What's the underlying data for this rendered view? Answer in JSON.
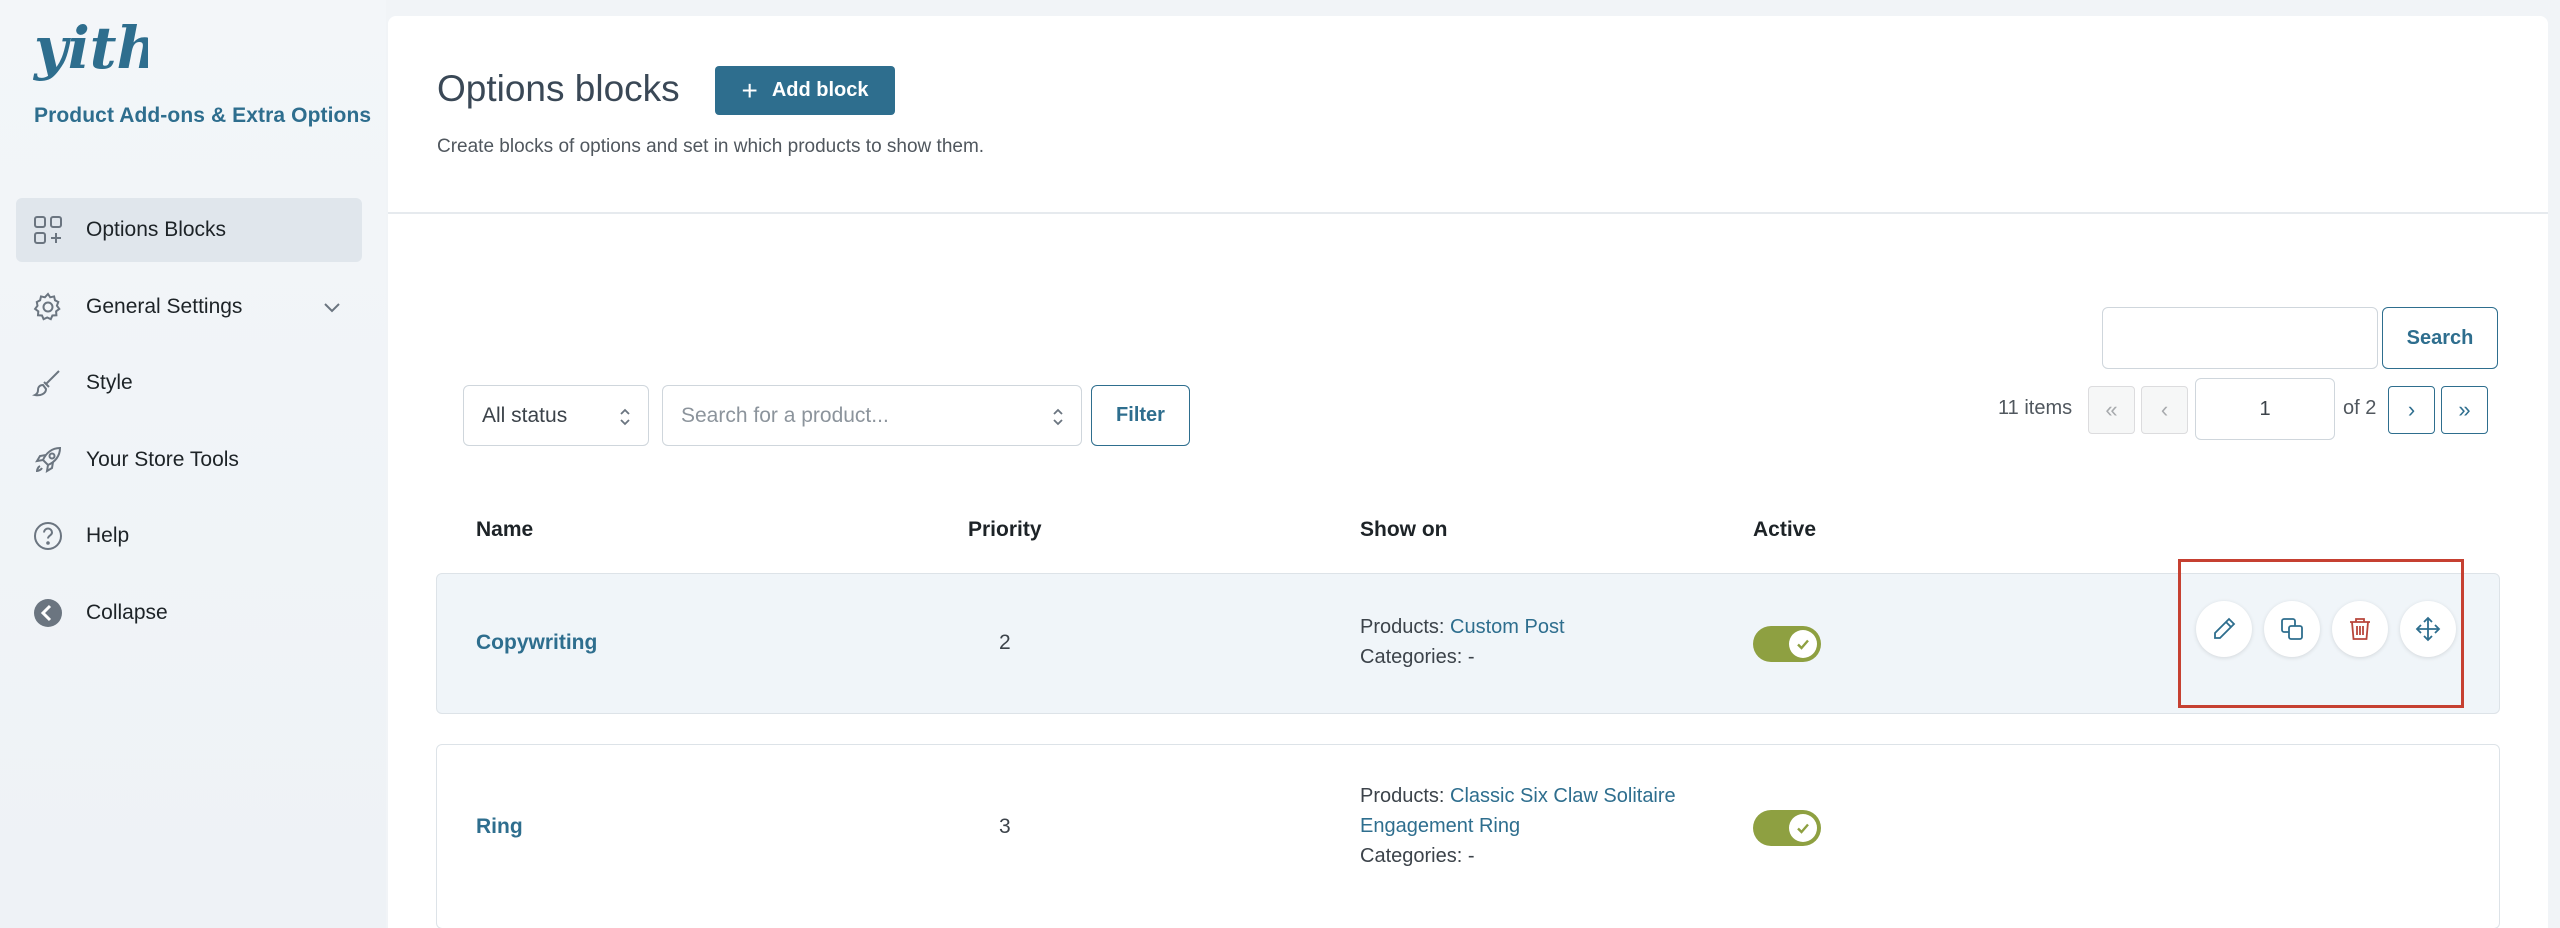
{
  "sidebar": {
    "logo_text": "yith",
    "plugin_name": "Product Add-ons & Extra Options",
    "items": [
      {
        "label": "Options Blocks",
        "icon": "blocks-icon",
        "active": true
      },
      {
        "label": "General Settings",
        "icon": "gear-icon",
        "has_submenu": true
      },
      {
        "label": "Style",
        "icon": "brush-icon"
      },
      {
        "label": "Your Store Tools",
        "icon": "rocket-icon"
      },
      {
        "label": "Help",
        "icon": "help-icon"
      },
      {
        "label": "Collapse",
        "icon": "collapse-arrow-icon"
      }
    ]
  },
  "header": {
    "title": "Options blocks",
    "add_button": "Add block",
    "description": "Create blocks of options and set in which products to show them."
  },
  "search": {
    "value": "",
    "button": "Search"
  },
  "filters": {
    "status_selected": "All status",
    "product_placeholder": "Search for a product...",
    "filter_button": "Filter"
  },
  "pagination": {
    "items_count": "11 items",
    "first": "«",
    "prev": "‹",
    "current_page": "1",
    "of_pages": "of 2",
    "next": "›",
    "last": "»"
  },
  "table": {
    "columns": [
      "Name",
      "Priority",
      "Show on",
      "Active"
    ],
    "rows": [
      {
        "name": "Copywriting",
        "priority": "2",
        "products_label": "Products:",
        "products_value": "Custom Post",
        "categories_label": "Categories:",
        "categories_value": "-",
        "active": true
      },
      {
        "name": "Ring",
        "priority": "3",
        "products_label": "Products:",
        "products_value_line1": "Classic Six Claw Solitaire",
        "products_value_line2": "Engagement Ring",
        "categories_label": "Categories:",
        "categories_value": "-",
        "active": true
      }
    ]
  },
  "row_actions": [
    "pencil-icon",
    "duplicate-icon",
    "trash-icon",
    "move-icon"
  ],
  "colors": {
    "brand": "#2e6e8e",
    "toggle_on": "#8ea041",
    "delete": "#b8463b",
    "highlight_box": "#c64031"
  }
}
